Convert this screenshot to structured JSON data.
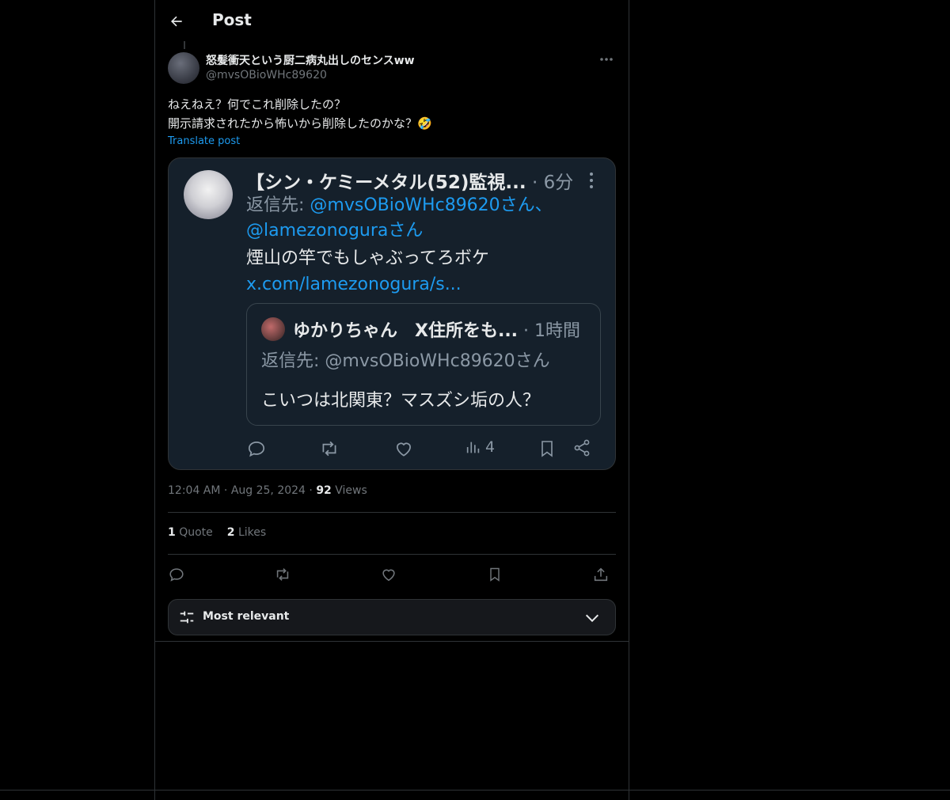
{
  "header": {
    "title": "Post"
  },
  "post": {
    "author_name": "怒髪衝天という厨二病丸出しのセンスww",
    "author_handle": "@mvsOBioWHc89620",
    "text_line1": "ねえねえ？何でこれ削除したの？",
    "text_line2": "開示請求されたから怖いから削除したのかな？🤣",
    "translate": "Translate post"
  },
  "embedded": {
    "name": "【シン・ケミーメタル(52)監視...",
    "time": " · 6分",
    "reply_prefix": "返信先: ",
    "reply_handle1": "@mvsOBioWHc89620さん、",
    "reply_handle2": "@lamezonoguraさん",
    "body": "煙山の竿でもしゃぶってろボケ",
    "link": "x.com/lamezonogura/s...",
    "views": "4",
    "quoted": {
      "name": "ゆかりちゃん　X住所をも...",
      "time": " · 1時間",
      "reply": "返信先: @mvsOBioWHc89620さん",
      "body": "こいつは北関東？マスズシ垢の人？"
    }
  },
  "meta": {
    "time": "12:04 AM",
    "sep1": " · ",
    "date": "Aug 25, 2024",
    "sep2": " · ",
    "views_count": "92",
    "views_label": " Views"
  },
  "stats": {
    "quotes_count": "1",
    "quotes_label": " Quote",
    "likes_count": "2",
    "likes_label": " Likes"
  },
  "sort": {
    "label": "Most relevant"
  },
  "colors": {
    "accent": "#1d9bf0",
    "muted": "#71767b",
    "text": "#e7e9ea",
    "background": "#000000",
    "card": "#15202b"
  }
}
